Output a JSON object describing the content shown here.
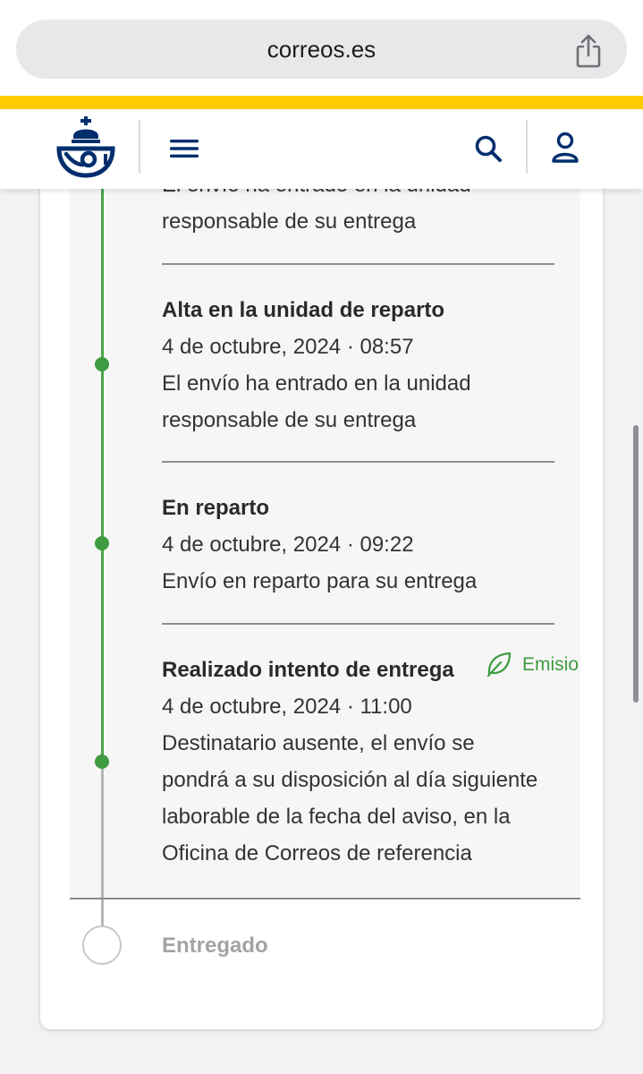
{
  "browser": {
    "url": "correos.es",
    "share_icon": "share-icon"
  },
  "header": {
    "logo": "correos-logo",
    "menu_icon": "hamburger-menu-icon",
    "search_icon": "search-icon",
    "user_icon": "user-icon",
    "accent_color": "#fecc00",
    "brand_color": "#002e6d"
  },
  "timeline": {
    "events": [
      {
        "title": "",
        "datetime": "",
        "description_line1": "El envío ha entrado en la unidad",
        "description_line2": "responsable de su entrega"
      },
      {
        "title": "Alta en la unidad de reparto",
        "datetime": "4 de octubre, 2024 · 08:57",
        "description_line1": "El envío ha entrado en la unidad",
        "description_line2": "responsable de su entrega"
      },
      {
        "title": "En reparto",
        "datetime": "4 de octubre, 2024 · 09:22",
        "description_line1": "Envío en reparto para su entrega"
      },
      {
        "title": "Realizado intento de entrega",
        "datetime": "4 de octubre, 2024 · 11:00",
        "description_line1": "Destinatario ausente, el envío se",
        "description_line2": "pondrá a su disposición al día siguiente",
        "description_line3": "laborable de la fecha del aviso, en la",
        "description_line4": "Oficina de Correos de referencia",
        "badge": "Emisio",
        "badge_icon": "leaf-icon"
      }
    ],
    "pending_step": "Entregado",
    "active_color": "#3f9b41",
    "inactive_color": "#a3a3a3"
  }
}
